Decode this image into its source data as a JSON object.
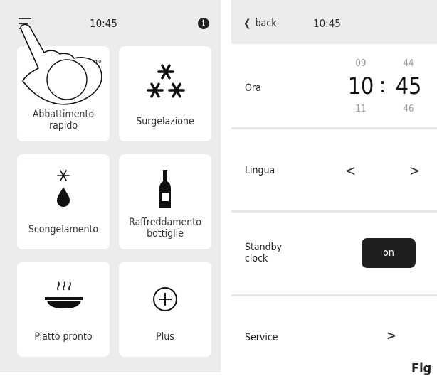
{
  "left": {
    "time": "10:45",
    "info_icon": "i",
    "tiles": [
      {
        "label": "Abbattimento rapido",
        "icon": "hand-tap-icon",
        "badge": "3°"
      },
      {
        "label": "Surgelazione",
        "icon": "snowflakes-icon"
      },
      {
        "label": "Scongelamento",
        "icon": "thaw-drop-icon"
      },
      {
        "label": "Raffreddamento bottiglie",
        "icon": "bottle-icon"
      },
      {
        "label": "Piatto pronto",
        "icon": "plate-icon"
      },
      {
        "label": "Plus",
        "icon": "plus-circle-icon"
      }
    ]
  },
  "right": {
    "back_label": "back",
    "time": "10:45",
    "ora": {
      "label": "Ora",
      "hour_prev": "09",
      "hour": "10",
      "hour_next": "11",
      "min_prev": "44",
      "min": "45",
      "min_next": "46",
      "separator": ":"
    },
    "lingua": {
      "label": "Lingua"
    },
    "standby": {
      "label_line1": "Standby",
      "label_line2": "clock",
      "toggle": "on"
    },
    "service": {
      "label": "Service"
    }
  },
  "caption": "Fig"
}
